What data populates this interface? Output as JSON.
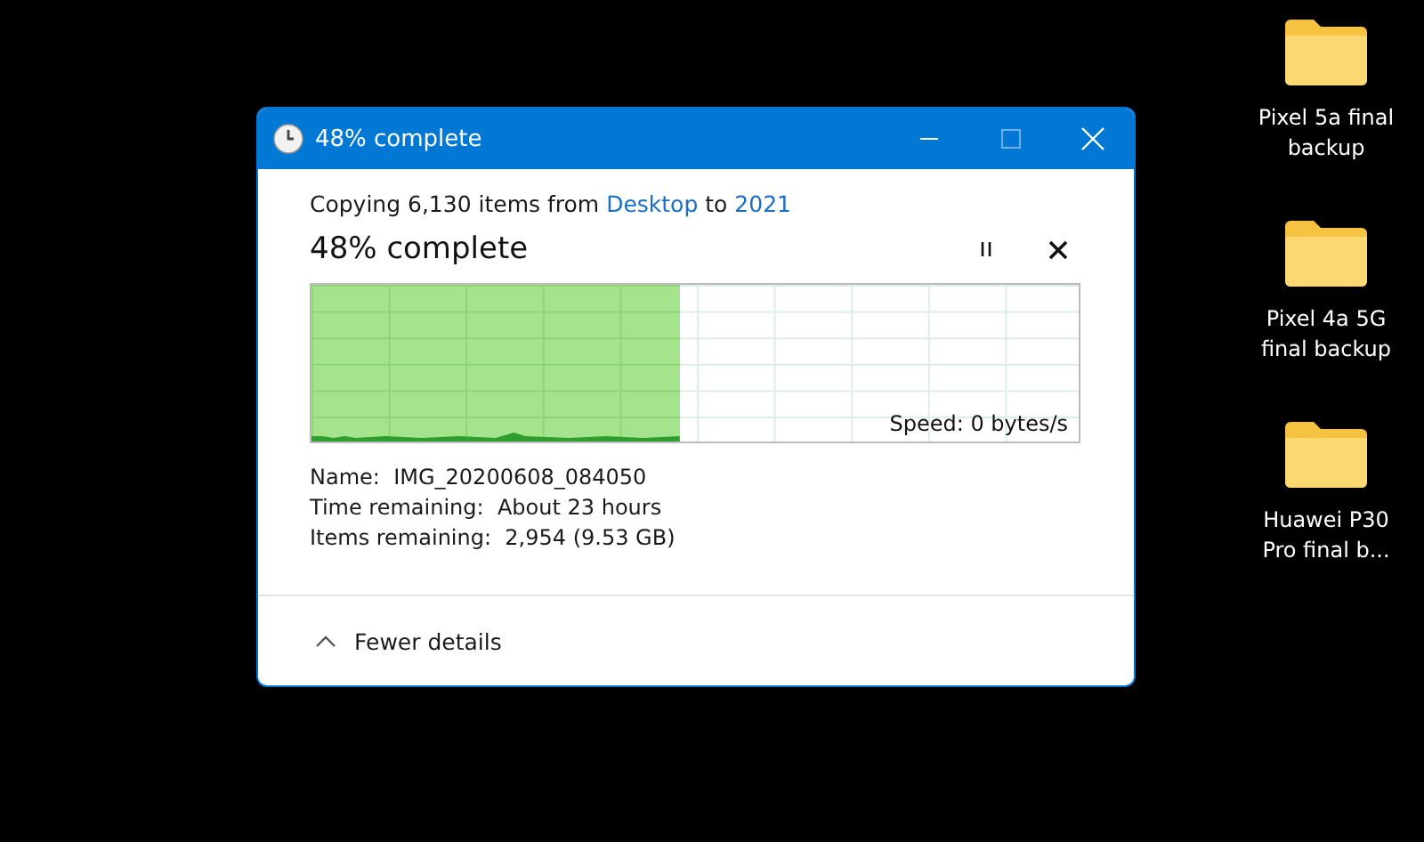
{
  "window": {
    "title": "48% complete"
  },
  "copy": {
    "prefix": "Copying 6,130 items from",
    "source": "Desktop",
    "middle": "to",
    "destination": "2021"
  },
  "progress": {
    "heading": "48% complete",
    "level": 0.48,
    "speed": "Speed: 0 bytes/s"
  },
  "details": [
    {
      "label": "Name:",
      "value": "IMG_20200608_084050"
    },
    {
      "label": "Time remaining:",
      "value": "About 23 hours"
    },
    {
      "label": "Items remaining:",
      "value": "2,954 (9.53 GB)"
    }
  ],
  "footer": {
    "toggle": "Fewer details",
    "expanded": true
  },
  "desktop_icons": [
    {
      "label": "Pixel 5a final backup"
    },
    {
      "label": "Pixel 4a 5G final backup"
    },
    {
      "label": "Huawei P30 Pro final b..."
    }
  ]
}
